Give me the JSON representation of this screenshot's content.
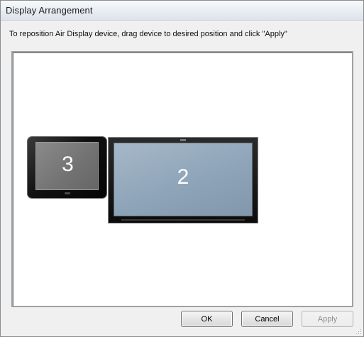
{
  "window": {
    "title": "Display Arrangement"
  },
  "instruction": "To reposition Air Display device, drag device to desired position and click \"Apply\"",
  "devices": [
    {
      "label": "3",
      "type": "tablet"
    },
    {
      "label": "2",
      "type": "monitor"
    }
  ],
  "buttons": {
    "ok": "OK",
    "cancel": "Cancel",
    "apply": "Apply"
  },
  "state": {
    "apply_enabled": false
  }
}
